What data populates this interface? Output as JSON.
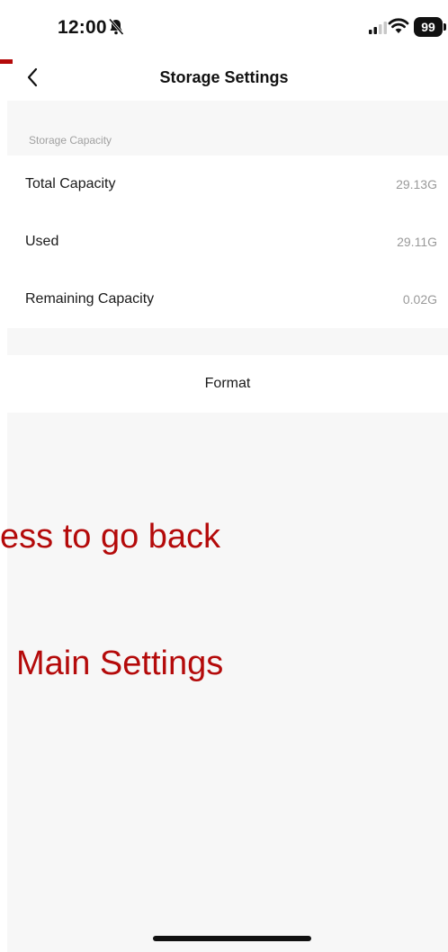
{
  "status_bar": {
    "time": "12:00",
    "battery": "99",
    "icons": [
      "bell-slash-icon",
      "signal-icon",
      "wifi-icon",
      "battery-icon"
    ]
  },
  "nav": {
    "title": "Storage Settings",
    "back_icon": "chevron-left-icon"
  },
  "storage": {
    "section_title": "Storage Capacity",
    "rows": [
      {
        "label": "Total Capacity",
        "value": "29.13G"
      },
      {
        "label": "Used",
        "value": "29.11G"
      },
      {
        "label": "Remaining Capacity",
        "value": "0.02G"
      }
    ]
  },
  "actions": {
    "format_label": "Format"
  },
  "annotation": {
    "line1": "ess to go back",
    "line2": "Main Settings",
    "color": "#b40a0a"
  }
}
